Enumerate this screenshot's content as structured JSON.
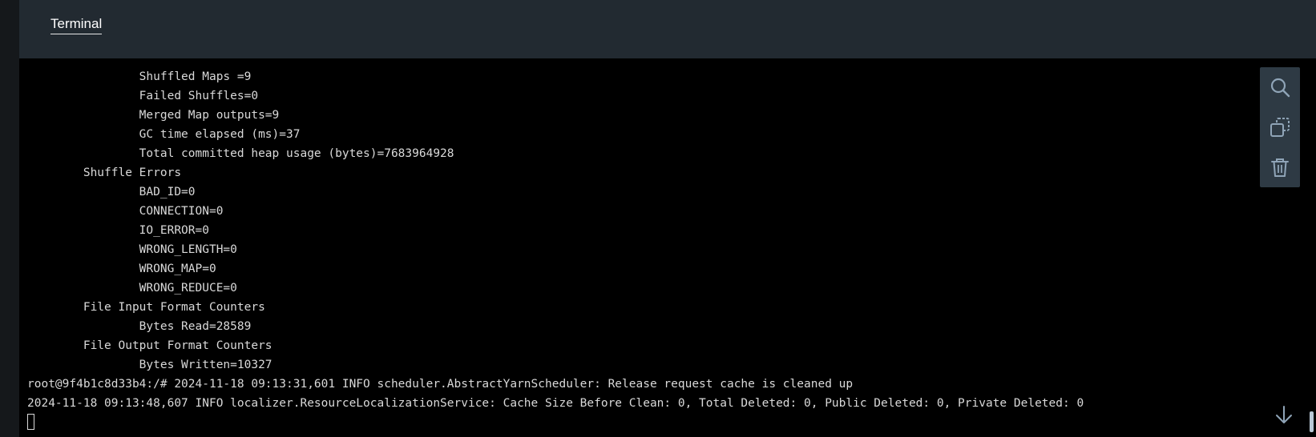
{
  "tab": {
    "label": "Terminal"
  },
  "terminal": {
    "lines": [
      "                Shuffled Maps =9",
      "                Failed Shuffles=0",
      "                Merged Map outputs=9",
      "                GC time elapsed (ms)=37",
      "                Total committed heap usage (bytes)=7683964928",
      "        Shuffle Errors",
      "                BAD_ID=0",
      "                CONNECTION=0",
      "                IO_ERROR=0",
      "                WRONG_LENGTH=0",
      "                WRONG_MAP=0",
      "                WRONG_REDUCE=0",
      "        File Input Format Counters",
      "                Bytes Read=28589",
      "        File Output Format Counters",
      "                Bytes Written=10327",
      "root@9f4b1c8d33b4:/# 2024-11-18 09:13:31,601 INFO scheduler.AbstractYarnScheduler: Release request cache is cleaned up",
      "2024-11-18 09:13:48,607 INFO localizer.ResourceLocalizationService: Cache Size Before Clean: 0, Total Deleted: 0, Public Deleted: 0, Private Deleted: 0"
    ]
  },
  "toolbar": {
    "icons": [
      "search-icon",
      "copy-icon",
      "trash-icon"
    ]
  },
  "scroll": {
    "icon": "arrow-down-icon"
  },
  "colors": {
    "tab_bar": "#222a31",
    "terminal_bg": "#000000",
    "text": "#d9d9d9",
    "toolbar_bg": "#2e3a44",
    "icon": "#8fa4b7"
  }
}
